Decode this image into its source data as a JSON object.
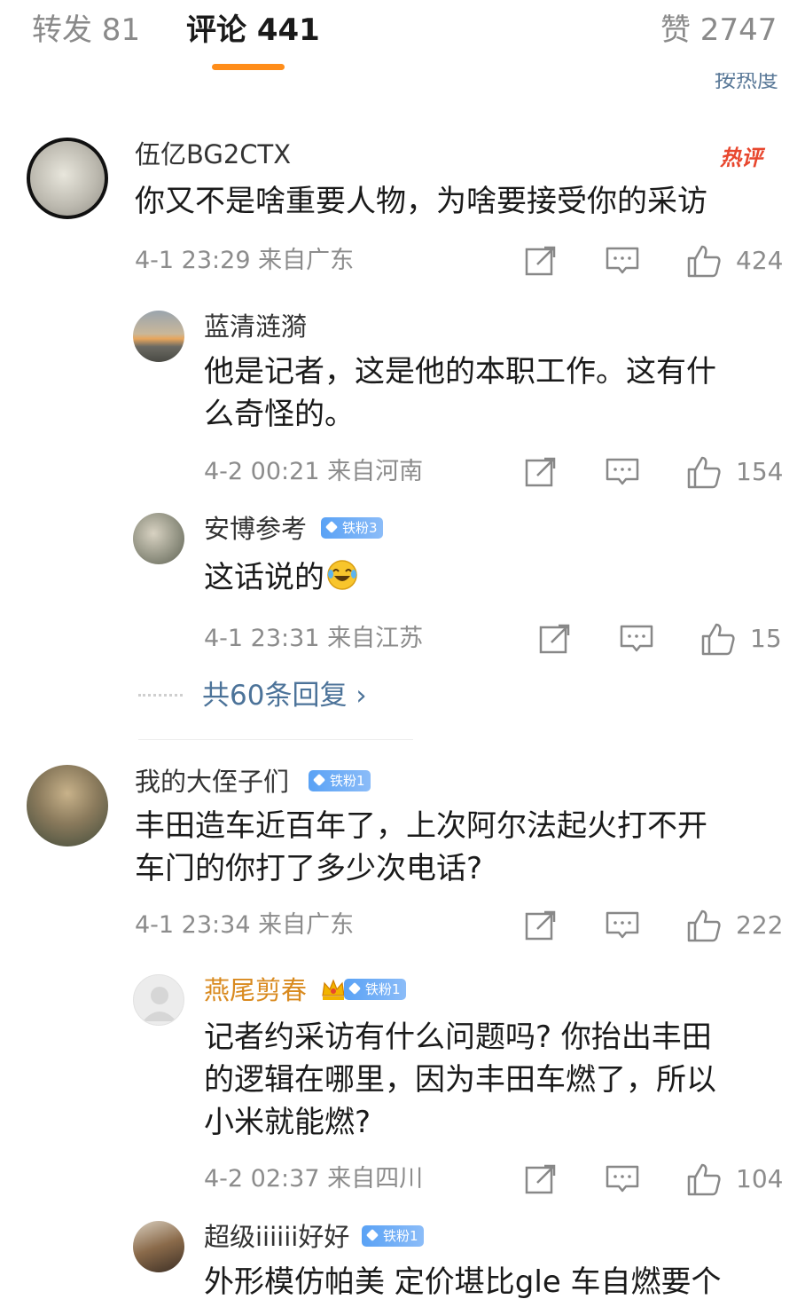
{
  "tabs": {
    "repost": "转发 81",
    "comments": "评论 441",
    "likes": "赞 2747"
  },
  "sort_label": "按热度",
  "hot_badge": "热评",
  "comments": [
    {
      "user": "伍亿BG2CTX",
      "text": "你又不是啥重要人物，为啥要接受你的采访",
      "meta": "4-1 23:29 来自广东",
      "likes": "424",
      "replies": [
        {
          "user": "蓝清涟漪",
          "text_lines": [
            "他是记者，这是他的本职工作。这有什",
            "么奇怪的。"
          ],
          "meta": "4-2 00:21 来自河南",
          "likes": "154"
        },
        {
          "user": "安博参考",
          "badge": "铁粉3",
          "text": "这话说的",
          "meta": "4-1 23:31 来自江苏",
          "likes": "15"
        }
      ],
      "more_replies": "共60条回复 ›"
    },
    {
      "user": "我的大侄子们",
      "badge": "铁粉1",
      "text_lines": [
        "丰田造车近百年了，上次阿尔法起火打不开",
        "车门的你打了多少次电话?"
      ],
      "meta": "4-1 23:34 来自广东",
      "likes": "222",
      "replies": [
        {
          "user": "燕尾剪春",
          "badge": "铁粉1",
          "text_lines": [
            "记者约采访有什么问题吗? 你抬出丰田",
            "的逻辑在哪里，因为丰田车燃了，所以",
            "小米就能燃?"
          ],
          "meta": "4-2 02:37 来自四川",
          "likes": "104"
        },
        {
          "user": "超级iiiiii好好",
          "badge": "铁粉1",
          "text_lines": [
            "外形模仿帕美 定价堪比gle 车自燃要个"
          ]
        }
      ]
    }
  ],
  "icons": [
    "repost-icon",
    "comment-icon",
    "like-icon",
    "laugh-cry-emoji",
    "crown-icon",
    "diamond-icon"
  ],
  "colors": {
    "accent": "#ff8d1a",
    "link": "#4c7399",
    "hot": "#e8472e",
    "fan_badge": "#5aa2f5",
    "vip_name": "#d98a1f"
  }
}
